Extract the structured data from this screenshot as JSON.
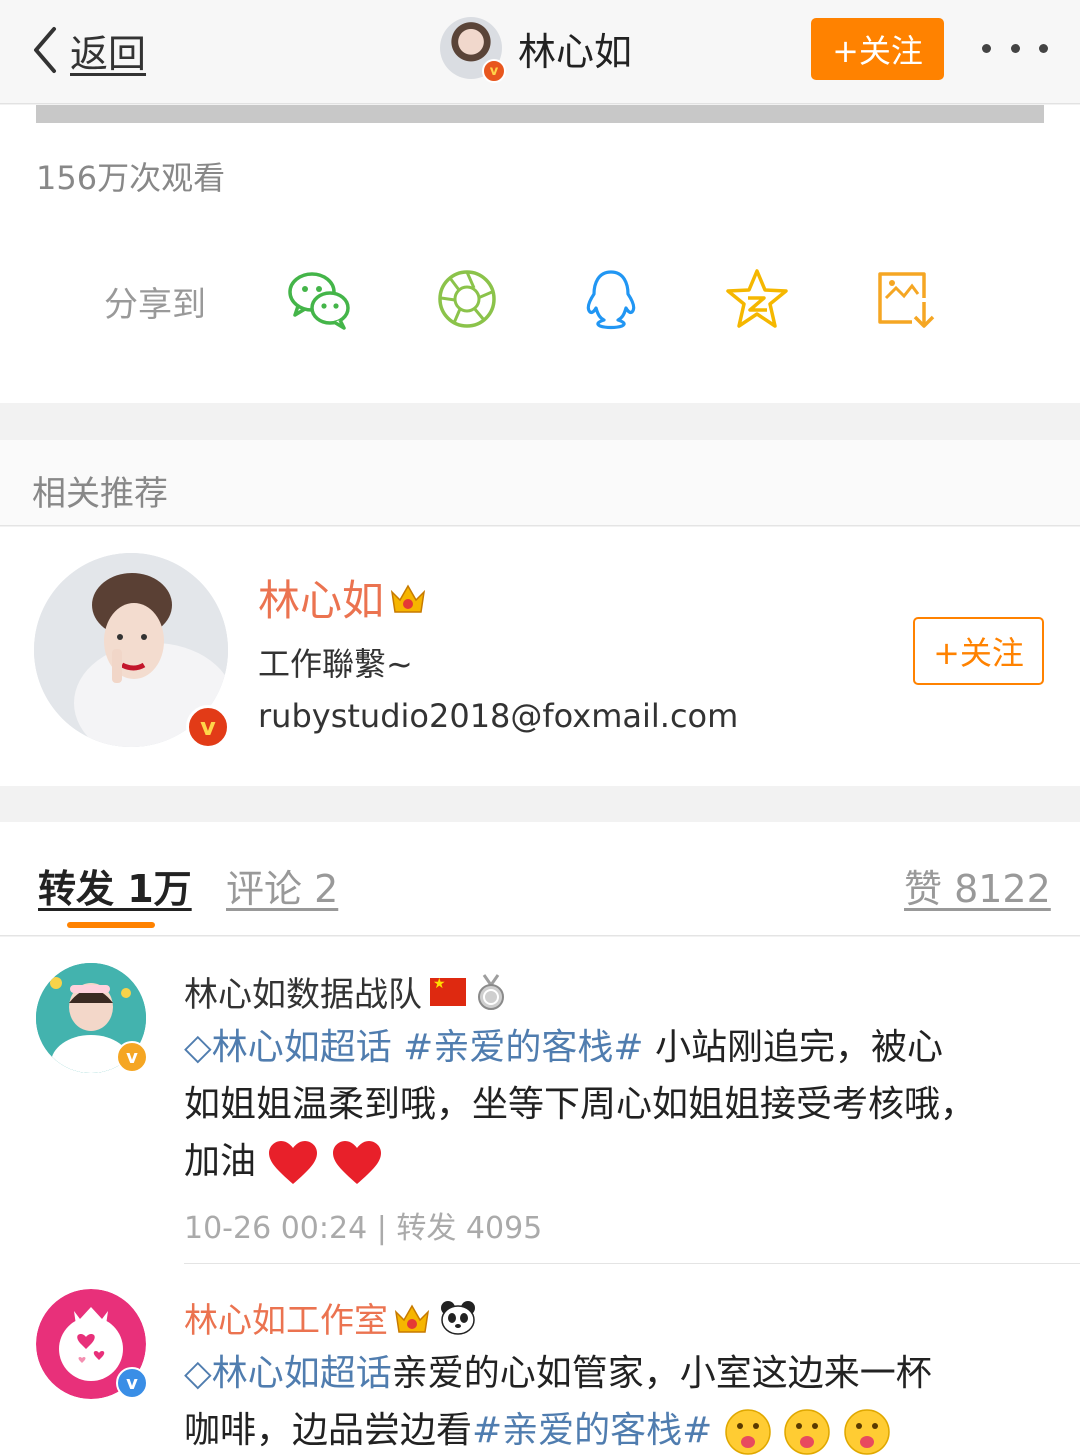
{
  "navbar": {
    "back_label": "返回",
    "title": "林心如",
    "follow_label": "+关注"
  },
  "video": {
    "views": "156万次观看"
  },
  "share": {
    "label": "分享到",
    "icons": [
      "wechat-icon",
      "moments-icon",
      "qq-icon",
      "qzone-icon",
      "save-image-icon"
    ],
    "colors": {
      "wechat": "#44b549",
      "moments": "#8bc34a",
      "qq": "#2196f3",
      "qzone": "#f5b700",
      "save": "#f5a623"
    }
  },
  "related": {
    "header": "相关推荐",
    "name": "林心如",
    "desc": "工作聯繫~",
    "email": "rubystudio2018@foxmail.com",
    "follow_label": "+关注"
  },
  "tabs": {
    "repost": "转发 1万",
    "comment": "评论 2",
    "like": "赞 8122"
  },
  "feed": [
    {
      "name": "林心如数据战队",
      "topic_super": "林心如超话",
      "topic_tag": "#亲爱的客栈#",
      "text_line1_rest": " 小站刚追完，被心",
      "text_line2": "如姐姐温柔到哦，坐等下周心如姐姐接受考核哦，",
      "text_line3": "加油",
      "time": "10-26 00:24",
      "sep": "|",
      "reposts": "转发 4095"
    },
    {
      "name": "林心如工作室",
      "topic_super": "林心如超话",
      "text_line1_rest": "亲爱的心如管家，小室这边来一杯",
      "text_line2_pre": "咖啡，边品尝边看",
      "topic_tag": "#亲爱的客栈#"
    }
  ],
  "colors": {
    "accent_orange": "#ff8200",
    "name_orange": "#eb7350",
    "topic_blue": "#507daf"
  }
}
